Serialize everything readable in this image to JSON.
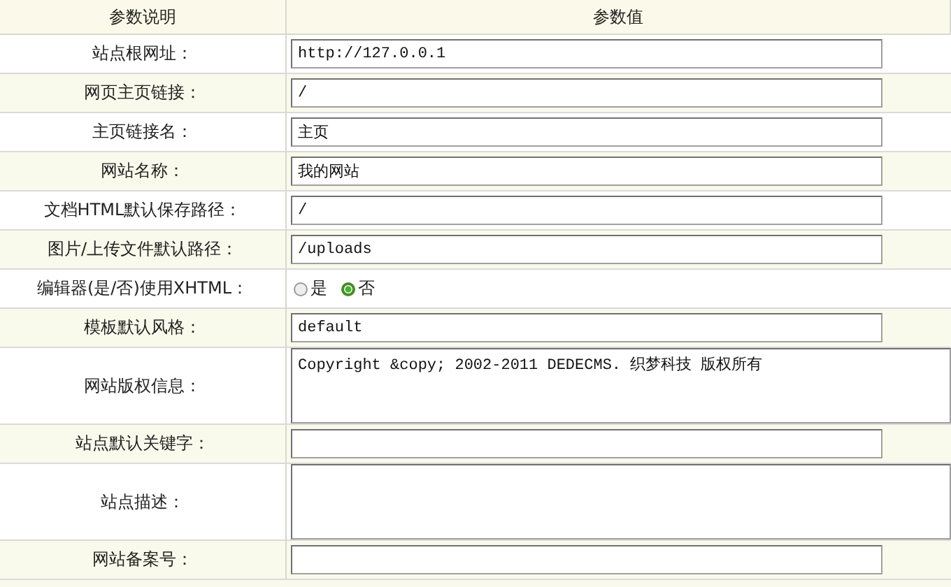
{
  "table": {
    "columns": [
      "参数说明",
      "参数值"
    ],
    "rows": [
      {
        "label": "站点根网址：",
        "kind": "text",
        "value": "http://127.0.0.1"
      },
      {
        "label": "网页主页链接：",
        "kind": "text",
        "value": "/"
      },
      {
        "label": "主页链接名：",
        "kind": "text",
        "value": "主页"
      },
      {
        "label": "网站名称：",
        "kind": "text",
        "value": "我的网站"
      },
      {
        "label": "文档HTML默认保存路径：",
        "kind": "text",
        "value": "/"
      },
      {
        "label": "图片/上传文件默认路径：",
        "kind": "text",
        "value": "/uploads"
      },
      {
        "label": "编辑器(是/否)使用XHTML：",
        "kind": "radio",
        "options": [
          {
            "label": "是",
            "selected": false
          },
          {
            "label": "否",
            "selected": true
          }
        ]
      },
      {
        "label": "模板默认风格：",
        "kind": "text",
        "value": "default"
      },
      {
        "label": "网站版权信息：",
        "kind": "textarea",
        "value": "Copyright &copy; 2002-2011 DEDECMS. 织梦科技 版权所有"
      },
      {
        "label": "站点默认关键字：",
        "kind": "text"
      },
      {
        "label": "站点描述：",
        "kind": "textarea"
      },
      {
        "label": "网站备案号：",
        "kind": "text"
      }
    ]
  }
}
